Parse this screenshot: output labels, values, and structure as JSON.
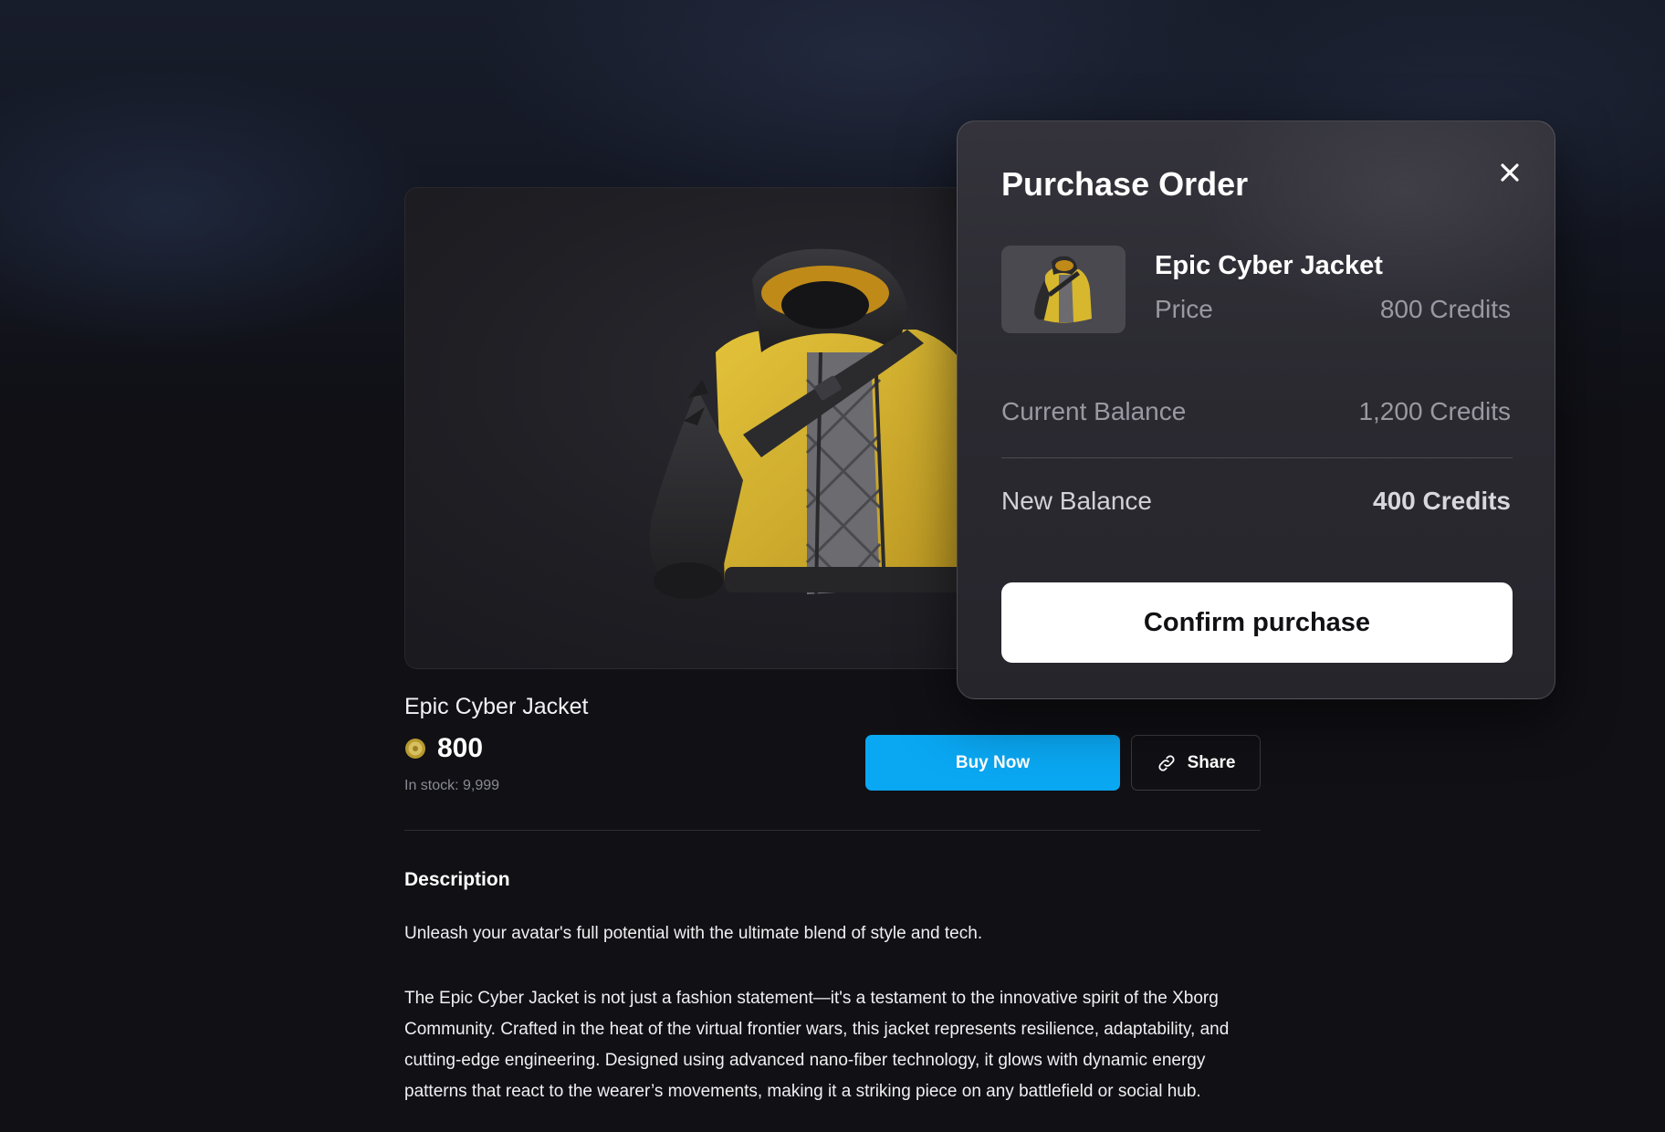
{
  "product": {
    "name": "Epic Cyber Jacket",
    "price": "800",
    "stock_label": "In stock: 9,999",
    "buy_label": "Buy Now",
    "share_label": "Share"
  },
  "description": {
    "title": "Description",
    "paragraph1": "Unleash your avatar's full potential with the ultimate blend of style and tech.",
    "paragraph2": "The Epic Cyber Jacket is not just a fashion statement—it's a testament to the innovative spirit of the Xborg Community. Crafted in the heat of the virtual frontier wars, this jacket represents resilience, adaptability, and cutting-edge engineering. Designed using advanced nano-fiber technology, it glows with dynamic energy patterns that react to the wearer’s movements, making it a striking piece on any battlefield or social hub."
  },
  "modal": {
    "title": "Purchase Order",
    "item_name": "Epic Cyber Jacket",
    "price_label": "Price",
    "price_value": "800 Credits",
    "current_balance_label": "Current Balance",
    "current_balance_value": "1,200 Credits",
    "new_balance_label": "New Balance",
    "new_balance_value": "400 Credits",
    "confirm_label": "Confirm purchase"
  },
  "icons": {
    "coin": "coin-icon",
    "share": "link-icon",
    "close": "close-icon"
  },
  "colors": {
    "buy_button": "#0aa7f2",
    "jacket_yellow": "#d9b42a",
    "background": "#101015"
  }
}
